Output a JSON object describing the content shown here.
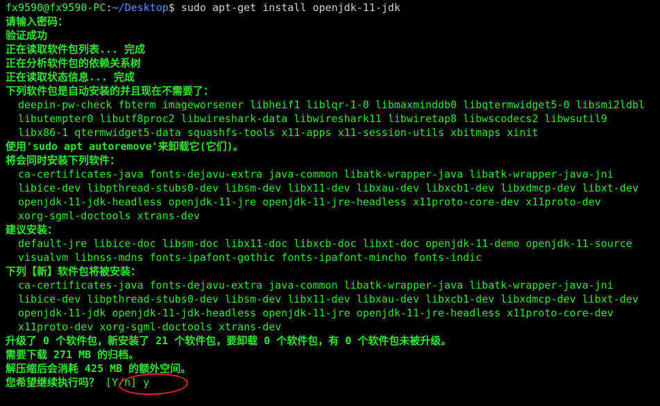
{
  "prompt": {
    "user_host": "fx9590@fx9590-PC",
    "separator": ":",
    "path": "~/Desktop",
    "symbol": "$",
    "command": " sudo apt-get install openjdk-11-jdk"
  },
  "output": {
    "password_prompt": "请输入密码：",
    "auth_ok": "验证成功",
    "reading_lists": "正在读取软件包列表... 完成",
    "building_tree": "正在分析软件包的依赖关系树",
    "reading_state": "正在读取状态信息... 完成",
    "auto_header": "下列软件包是自动安装的并且现在不需要了：",
    "auto_lines": [
      "deepin-pw-check fbterm imageworsener libheif1 liblqr-1-0 libmaxminddb0 libqtermwidget5-0 libsmi2ldbl",
      "libutempter0 libutf8proc2 libwireshark-data libwireshark11 libwiretap8 libwscodecs2 libwsutil9",
      "libx86-1 qtermwidget5-data squashfs-tools x11-apps x11-session-utils xbitmaps xinit"
    ],
    "autoremove_hint": "使用'sudo apt autoremove'来卸载它(它们)。",
    "extra_header": "将会同时安装下列软件：",
    "extra_lines": [
      "ca-certificates-java fonts-dejavu-extra java-common libatk-wrapper-java libatk-wrapper-java-jni",
      "libice-dev libpthread-stubs0-dev libsm-dev libx11-dev libxau-dev libxcb1-dev libxdmcp-dev libxt-dev",
      "openjdk-11-jdk-headless openjdk-11-jre openjdk-11-jre-headless x11proto-core-dev x11proto-dev",
      "xorg-sgml-doctools xtrans-dev"
    ],
    "suggested_header": "建议安装：",
    "suggested_lines": [
      "default-jre libice-doc libsm-doc libx11-doc libxcb-doc libxt-doc openjdk-11-demo openjdk-11-source",
      "visualvm libnss-mdns fonts-ipafont-gothic fonts-ipafont-mincho fonts-indic"
    ],
    "new_header": "下列【新】软件包将被安装：",
    "new_lines": [
      "ca-certificates-java fonts-dejavu-extra java-common libatk-wrapper-java libatk-wrapper-java-jni",
      "libice-dev libpthread-stubs0-dev libsm-dev libx11-dev libxau-dev libxcb1-dev libxdmcp-dev libxt-dev",
      "openjdk-11-jdk openjdk-11-jdk-headless openjdk-11-jre openjdk-11-jre-headless x11proto-core-dev",
      "x11proto-dev xorg-sgml-doctools xtrans-dev"
    ],
    "summary": "升级了 0 个软件包，新安装了 21 个软件包，要卸载 0 个软件包，有 0 个软件包未被升级。",
    "download_size": "需要下载 271 MB 的归档。",
    "disk_usage": "解压缩后会消耗 425 MB 的额外空间。",
    "continue_question": "您希望继续执行吗？ ",
    "continue_answer": "[Y/n] y"
  },
  "colors": {
    "background": "#000000",
    "text_green": "#2ee82e",
    "path_blue": "#5c8cff",
    "annotation_red": "#e8203c"
  }
}
